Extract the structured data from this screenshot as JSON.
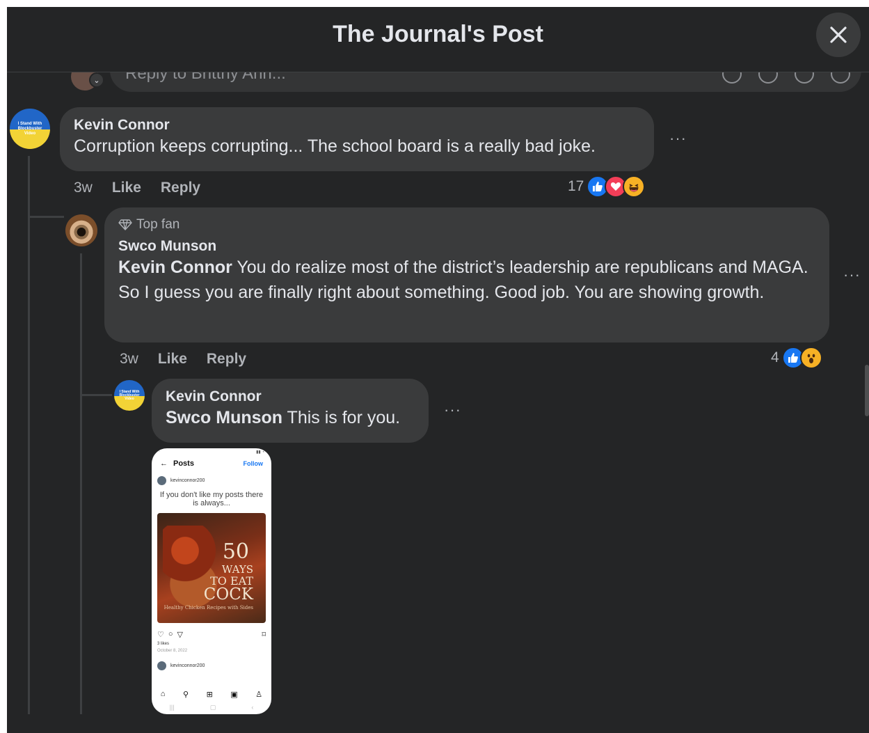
{
  "header": {
    "title": "The Journal's Post",
    "close_icon": "close-icon"
  },
  "composer": {
    "placeholder": "Reply to Brittny Ann..."
  },
  "comments": [
    {
      "author": "Kevin Connor",
      "avatar_text": "I Stand With Blockbuster Video",
      "text": "Corruption keeps corrupting... The school board is a really bad joke.",
      "time": "3w",
      "like_label": "Like",
      "reply_label": "Reply",
      "reaction_count": "17",
      "reactions": [
        "like",
        "love",
        "haha"
      ]
    },
    {
      "badge": "Top fan",
      "author": "Swco Munson",
      "mention": "Kevin Connor",
      "text": " You do realize most of the district’s leadership are republicans and MAGA. So I guess you are finally right about something. Good job. You are showing growth.",
      "time": "3w",
      "like_label": "Like",
      "reply_label": "Reply",
      "reaction_count": "4",
      "reactions": [
        "like",
        "wow"
      ]
    },
    {
      "author": "Kevin Connor",
      "mention": "Swco Munson",
      "text": " This is for you.",
      "attachment": {
        "screen_title": "Posts",
        "follow_label": "Follow",
        "username": "kevinconnor200",
        "caption": "If you don't like my posts there is always...",
        "cover_number": "50",
        "cover_line1": "WAYS",
        "cover_line2": "TO EAT",
        "cover_line3": "COCK",
        "cover_subtitle": "Healthy Chicken Recipes with Sides",
        "likes_text": "3 likes",
        "date_text": "October 8, 2022",
        "username2": "kevinconnor200"
      }
    }
  ],
  "more_label": "···",
  "colors": {
    "background": "#242526",
    "bubble": "#3a3b3c",
    "text": "#e4e6eb",
    "secondary": "#b0b3b8",
    "like_blue": "#1877f2",
    "love_red": "#f33e58",
    "emoji_yellow": "#f7b125"
  }
}
